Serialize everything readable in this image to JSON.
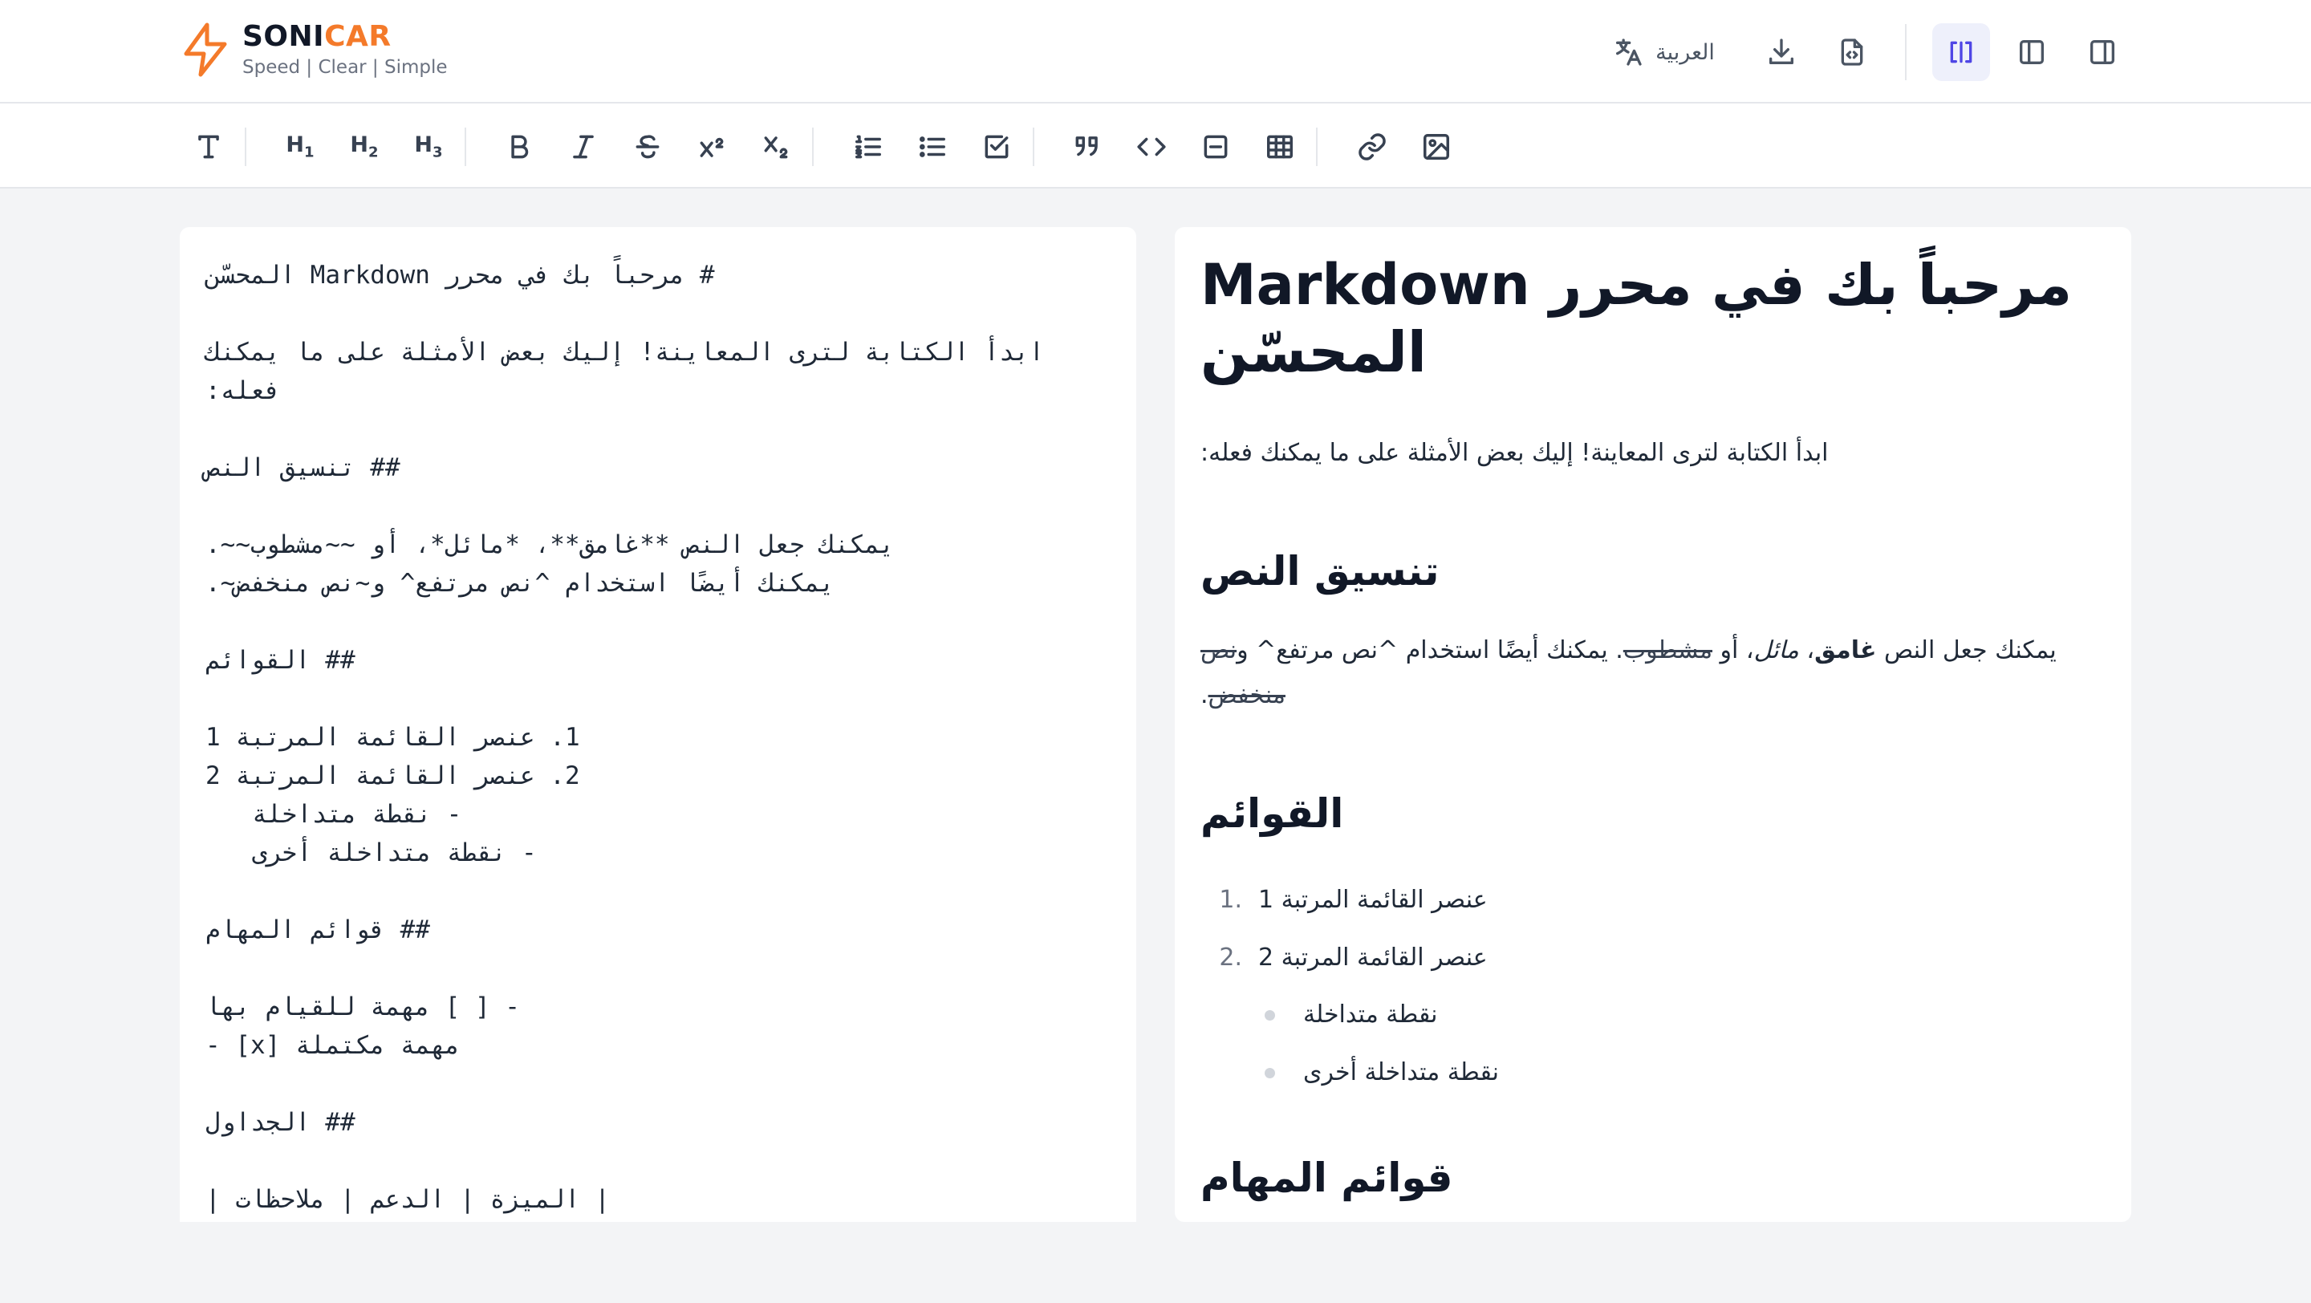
{
  "app": {
    "brand_part1": "SONI",
    "brand_part2": "CAR",
    "tagline": "Speed | Clear | Simple",
    "accent_color": "#f47a2a",
    "active_color": "#4f46e5"
  },
  "header": {
    "language_label": "العربية",
    "icons": [
      "translate-icon",
      "download-icon",
      "export-code-icon",
      "split-view-icon",
      "editor-only-icon",
      "preview-only-icon"
    ]
  },
  "toolbar": {
    "h1": "H",
    "h1_sub": "1",
    "h2": "H",
    "h2_sub": "2",
    "h3": "H",
    "h3_sub": "3",
    "icons": [
      "text-icon",
      "bold-icon",
      "italic-icon",
      "strikethrough-icon",
      "superscript-icon",
      "subscript-icon",
      "ordered-list-icon",
      "bullet-list-icon",
      "task-list-icon",
      "quote-icon",
      "code-icon",
      "horizontal-rule-icon",
      "table-icon",
      "link-icon",
      "image-icon"
    ]
  },
  "editor": {
    "lines": [
      "# مرحباً بك في محرر Markdown المحسّن",
      "",
      "ابدأ الكتابة لترى المعاينة! إليك بعض الأمثلة على ما يمكنك",
      "فعله:",
      "",
      "## تنسيق النص",
      "",
      "يمكنك جعل النص **غامق**، *مائل*، أو ~~مشطوب~~.",
      "يمكنك أيضًا استخدام ^نص مرتفع^ و~نص منخفض~.",
      "",
      "## القوائم",
      "",
      "1. عنصر القائمة المرتبة 1",
      "2. عنصر القائمة المرتبة 2",
      "- نقطة متداخلة",
      "- نقطة متداخلة أخرى",
      "",
      "## قوائم المهام",
      "",
      "- [ ] مهمة للقيام بها",
      "- [x] مهمة مكتملة",
      "",
      "## الجداول",
      "",
      "| الميزة | الدعم | ملاحظات |"
    ]
  },
  "preview": {
    "h1": "مرحباً بك في محرر Markdown المحسّن",
    "intro": "ابدأ الكتابة لترى المعاينة! إليك بعض الأمثلة على ما يمكنك فعله:",
    "h2_formatting": "تنسيق النص",
    "fmt_1": "يمكنك جعل النص ",
    "fmt_bold": "غامق",
    "fmt_2": "، ",
    "fmt_italic": "مائل",
    "fmt_3": "، أو ",
    "fmt_strike": "مشطوب",
    "fmt_4": ". يمكنك أيضًا استخدام ^نص مرتفع^ و",
    "fmt_strike2": "نص منخفض",
    "fmt_5": ".",
    "h2_lists": "القوائم",
    "ol": [
      {
        "num": "1.",
        "text": "عنصر القائمة المرتبة 1"
      },
      {
        "num": "2.",
        "text": "عنصر القائمة المرتبة 2"
      }
    ],
    "ul": [
      "نقطة متداخلة",
      "نقطة متداخلة أخرى"
    ],
    "h2_tasks": "قوائم المهام"
  }
}
